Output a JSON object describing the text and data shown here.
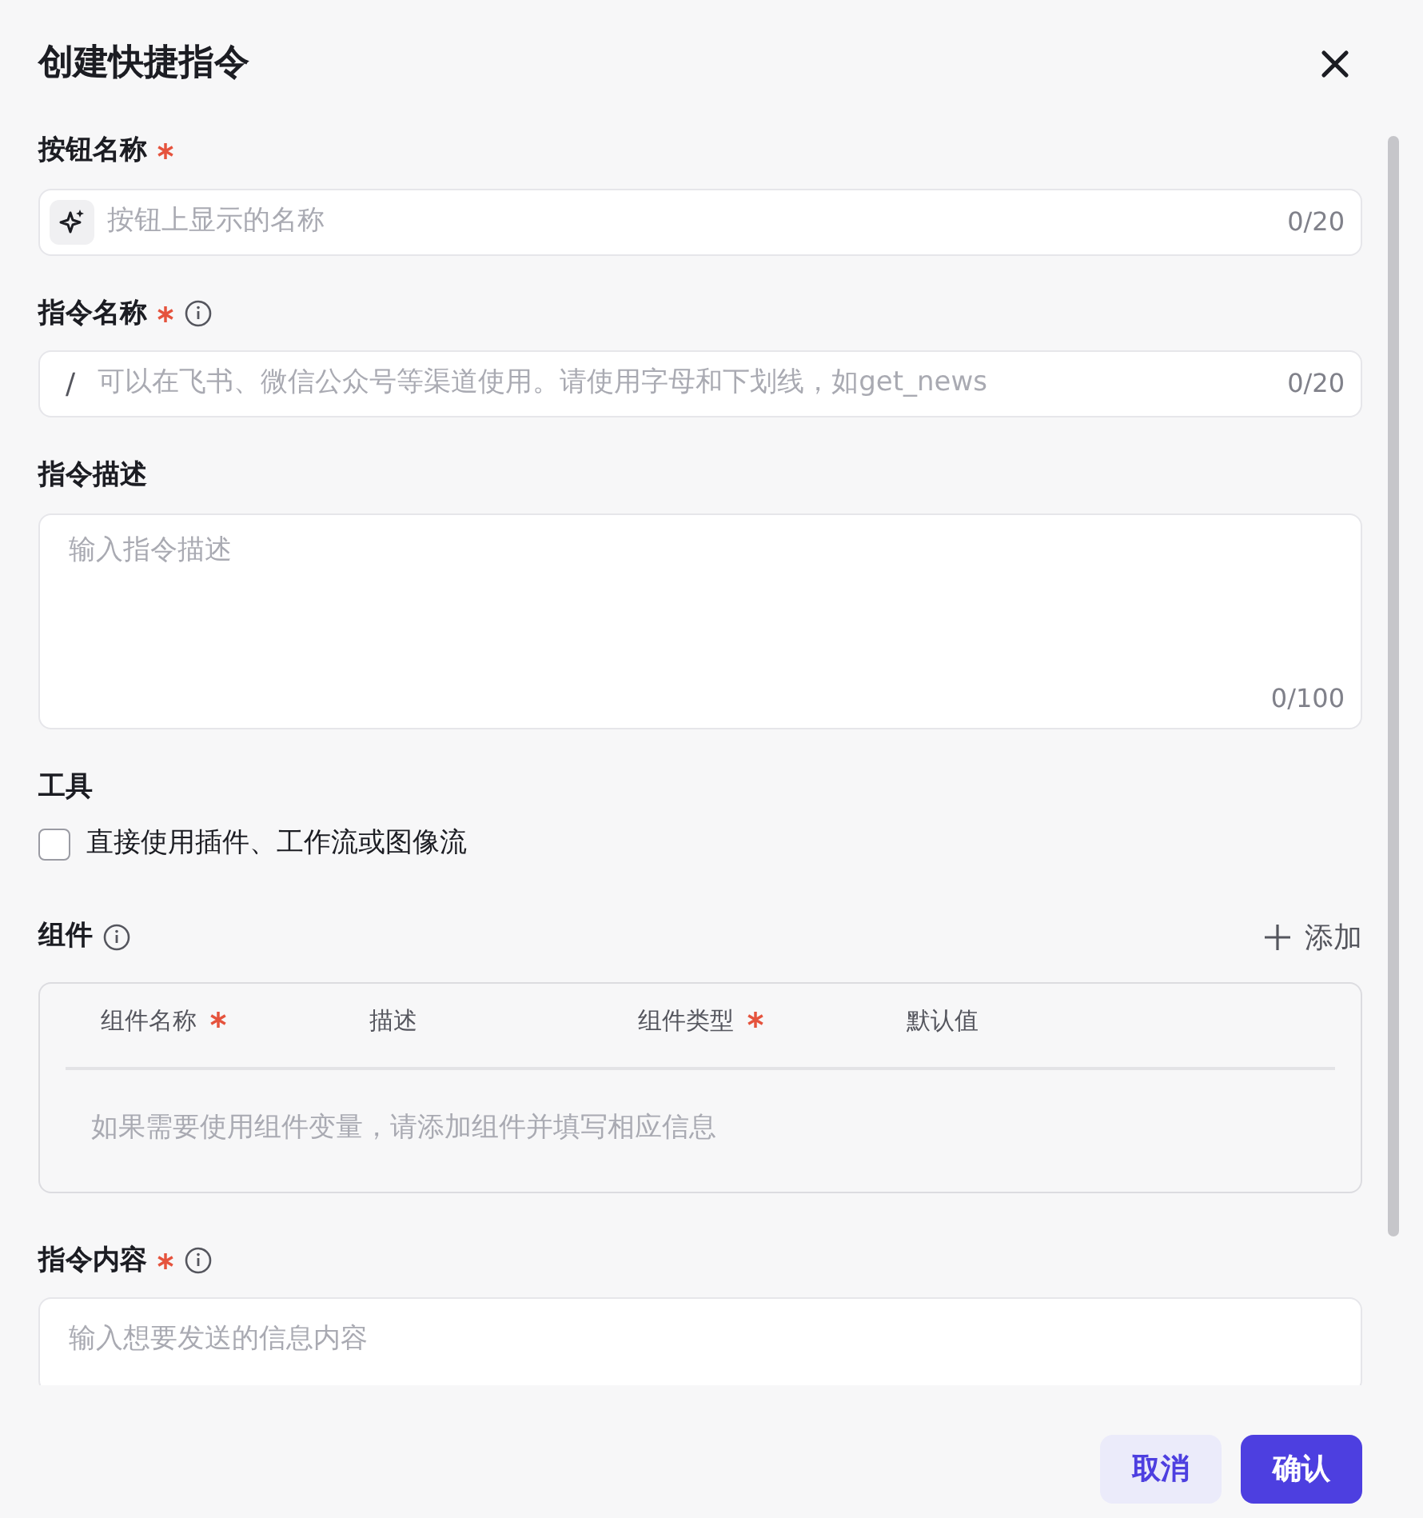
{
  "dialog": {
    "title": "创建快捷指令"
  },
  "sections": [
    {
      "kind": "input",
      "label": "按钮名称",
      "required": true,
      "info": false,
      "icon_prefix": true,
      "placeholder": "按钮上显示的名称",
      "counter": "0/20"
    },
    {
      "kind": "input",
      "label": "指令名称",
      "required": true,
      "info": true,
      "prefix_text": "/",
      "placeholder": "可以在飞书、微信公众号等渠道使用。请使用字母和下划线，如get_news",
      "counter": "0/20"
    },
    {
      "kind": "textarea",
      "label": "指令描述",
      "required": false,
      "info": false,
      "placeholder": "输入指令描述",
      "counter": "0/100"
    },
    {
      "kind": "checkbox",
      "label": "工具",
      "option": "直接使用插件、工作流或图像流",
      "checked": false
    },
    {
      "kind": "table",
      "label": "组件",
      "info": true,
      "add": "添加",
      "columns": [
        {
          "label": "组件名称",
          "required": true
        },
        {
          "label": "描述",
          "required": false
        },
        {
          "label": "组件类型",
          "required": true
        },
        {
          "label": "默认值",
          "required": false
        }
      ],
      "empty": "如果需要使用组件变量，请添加组件并填写相应信息"
    },
    {
      "kind": "input",
      "label": "指令内容",
      "required": true,
      "info": true,
      "placeholder": "输入想要发送的信息内容",
      "tall": true
    }
  ],
  "footer": [
    {
      "label": "取消",
      "primary": false
    },
    {
      "label": "确认",
      "primary": true
    }
  ]
}
